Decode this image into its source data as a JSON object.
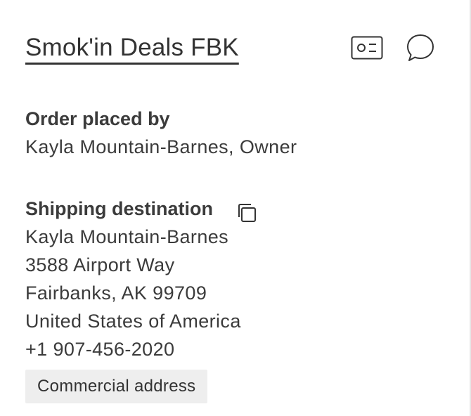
{
  "buyer": {
    "name": "Smok'in Deals FBK"
  },
  "header_icons": {
    "id_card": "id-card-icon",
    "message": "message-bubble-icon"
  },
  "order_placed_by": {
    "label": "Order placed by",
    "value": "Kayla Mountain-Barnes, Owner"
  },
  "shipping": {
    "label": "Shipping destination",
    "copy_icon": "copy-icon",
    "lines": [
      "Kayla Mountain-Barnes",
      "3588 Airport Way",
      "Fairbanks, AK 99709",
      "United States of America",
      "+1 907-456-2020"
    ],
    "address_type_badge": "Commercial address"
  }
}
